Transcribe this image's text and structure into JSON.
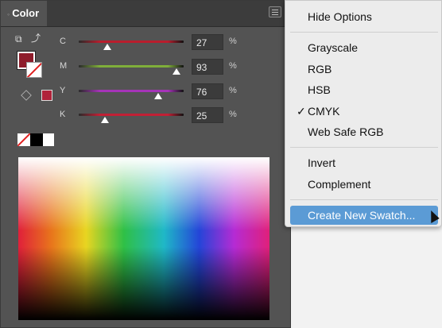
{
  "panel": {
    "tab_title": "Color",
    "tab_dot": "◦",
    "channels": [
      {
        "label": "C",
        "value": "27",
        "unit": "%",
        "level": 0.27,
        "track_color": "#b91d2d"
      },
      {
        "label": "M",
        "value": "93",
        "unit": "%",
        "level": 0.93,
        "track_color": "#7fae3a"
      },
      {
        "label": "Y",
        "value": "76",
        "unit": "%",
        "level": 0.76,
        "track_color": "#a534b8"
      },
      {
        "label": "K",
        "value": "25",
        "unit": "%",
        "level": 0.25,
        "track_color": "#c22035"
      }
    ],
    "fill_color": "#8e1c2b",
    "gamut_color": "#b0233a"
  },
  "menu": {
    "hide_options": "Hide Options",
    "grayscale": "Grayscale",
    "rgb": "RGB",
    "hsb": "HSB",
    "cmyk": "CMYK",
    "web_safe_rgb": "Web Safe RGB",
    "invert": "Invert",
    "complement": "Complement",
    "create_new_swatch": "Create New Swatch...",
    "check_mark": "✓"
  }
}
